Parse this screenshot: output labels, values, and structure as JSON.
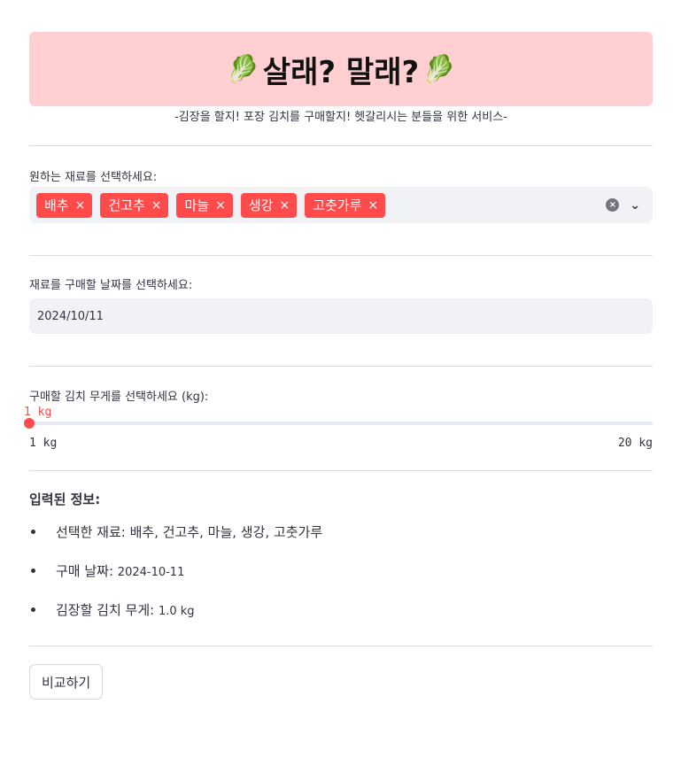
{
  "hero": {
    "emoji_left": "🥬",
    "title": "살래? 말래?",
    "emoji_right": "🥬",
    "subtitle": "-김장을 할지! 포장 김치를 구매할지! 헷갈리시는 분들을 위한 서비스-"
  },
  "ingredients": {
    "label": "원하는 재료를 선택하세요:",
    "selected": [
      "배추",
      "건고추",
      "마늘",
      "생강",
      "고춧가루"
    ],
    "remove_glyph": "×",
    "clear_glyph": "×",
    "dropdown_glyph": "⌄"
  },
  "date": {
    "label": "재료를 구매할 날짜를 선택하세요:",
    "value": "2024/10/11"
  },
  "weight": {
    "label": "구매할 김치 무게를 선택하세요 (kg):",
    "value_text": "1 kg",
    "min_text": "1 kg",
    "max_text": "20 kg",
    "value": 1,
    "min": 1,
    "max": 20
  },
  "info": {
    "heading": "입력된 정보:",
    "items": [
      {
        "label": "선택한 재료: ",
        "value": "배추, 건고추, 마늘, 생강, 고춧가루"
      },
      {
        "label": "구매 날짜: ",
        "value": "2024-10-11"
      },
      {
        "label": "김장할 김치 무게: ",
        "value": "1.0 kg"
      }
    ]
  },
  "compare_button": "비교하기",
  "colors": {
    "accent": "#ff4b4b",
    "hero_bg": "#ffcfd2",
    "input_bg": "#f0f2f6",
    "text": "#31333f"
  }
}
